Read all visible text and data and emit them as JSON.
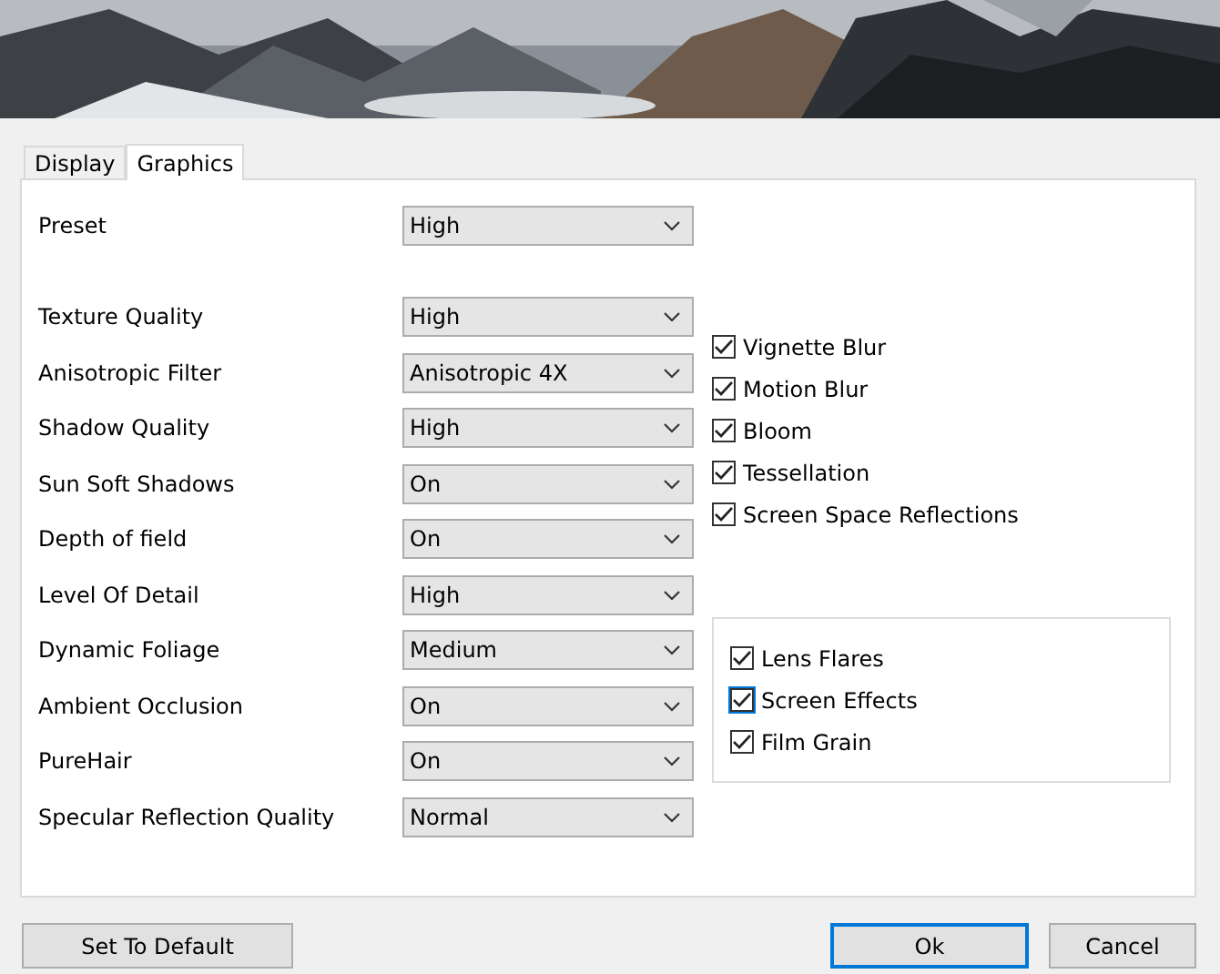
{
  "tabs": [
    {
      "label": "Display",
      "selected": false
    },
    {
      "label": "Graphics",
      "selected": true
    }
  ],
  "preset": {
    "label": "Preset",
    "value": "High"
  },
  "settings": [
    {
      "label": "Texture Quality",
      "value": "High"
    },
    {
      "label": "Anisotropic Filter",
      "value": "Anisotropic 4X"
    },
    {
      "label": "Shadow Quality",
      "value": "High"
    },
    {
      "label": "Sun Soft Shadows",
      "value": "On"
    },
    {
      "label": "Depth of field",
      "value": "On"
    },
    {
      "label": "Level Of Detail",
      "value": "High"
    },
    {
      "label": "Dynamic Foliage",
      "value": "Medium"
    },
    {
      "label": "Ambient Occlusion",
      "value": "On"
    },
    {
      "label": "PureHair",
      "value": "On"
    },
    {
      "label": "Specular Reflection Quality",
      "value": "Normal"
    }
  ],
  "effects": [
    {
      "label": "Vignette Blur",
      "checked": true
    },
    {
      "label": "Motion Blur",
      "checked": true
    },
    {
      "label": "Bloom",
      "checked": true
    },
    {
      "label": "Tessellation",
      "checked": true
    },
    {
      "label": "Screen Space Reflections",
      "checked": true
    }
  ],
  "post_effects": [
    {
      "label": "Lens Flares",
      "checked": true,
      "focused": false
    },
    {
      "label": "Screen Effects",
      "checked": true,
      "focused": true
    },
    {
      "label": "Film Grain",
      "checked": true,
      "focused": false
    }
  ],
  "buttons": [
    {
      "label": "Set To Default",
      "kind": "normal"
    },
    {
      "label": "Ok",
      "kind": "default"
    },
    {
      "label": "Cancel",
      "kind": "normal"
    }
  ]
}
